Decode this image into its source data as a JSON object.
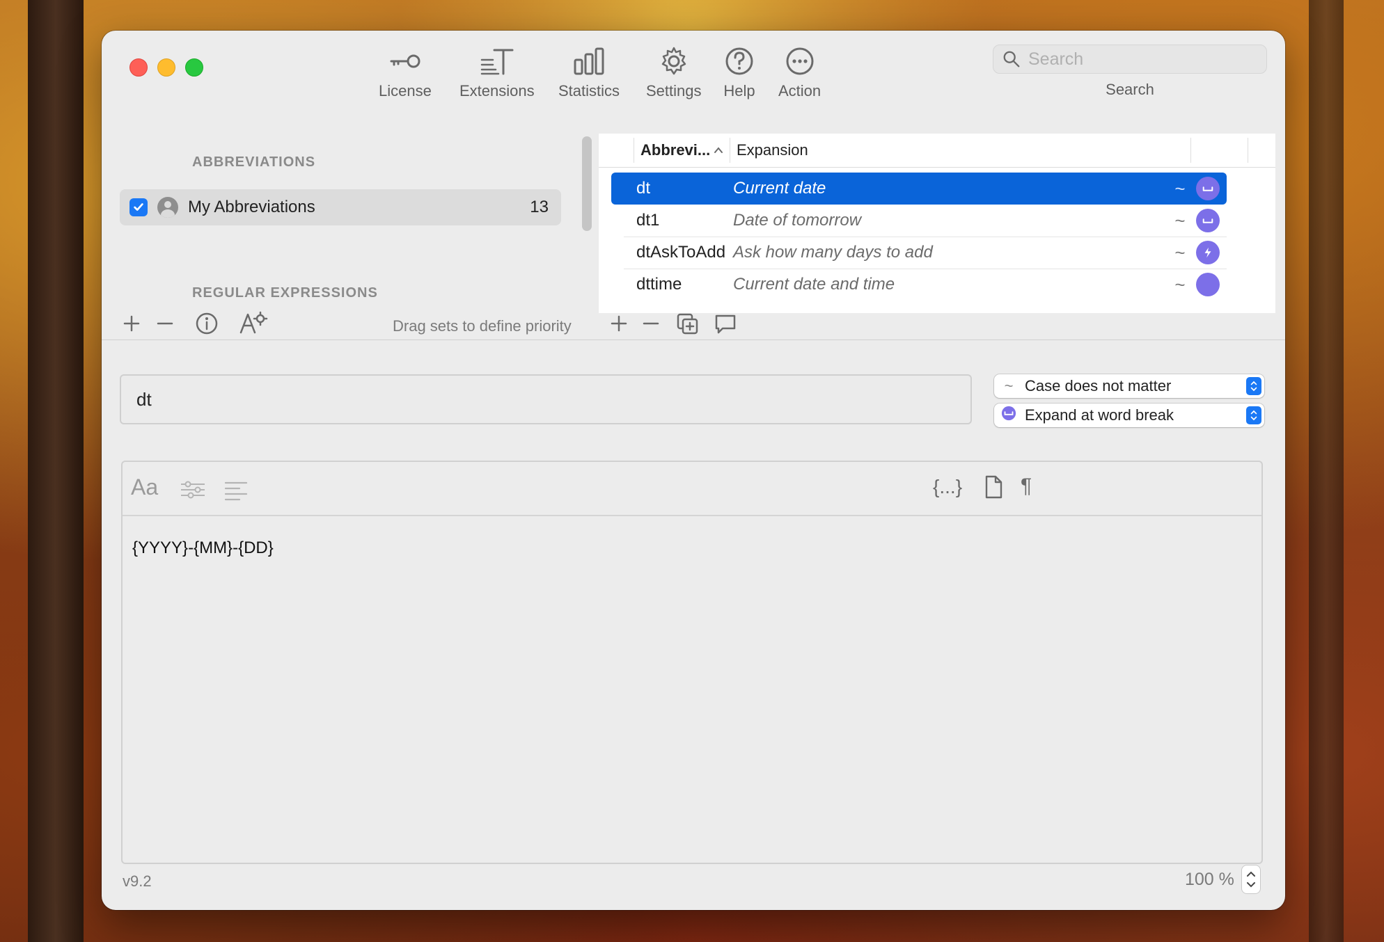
{
  "toolbar": {
    "license": "License",
    "extensions": "Extensions",
    "statistics": "Statistics",
    "settings": "Settings",
    "help": "Help",
    "action": "Action",
    "search_placeholder": "Search",
    "search_label": "Search"
  },
  "sidebar": {
    "abbreviations_header": "ABBREVIATIONS",
    "set_name": "My Abbreviations",
    "set_count": "13",
    "regex_header": "REGULAR EXPRESSIONS",
    "drag_hint": "Drag sets to define priority"
  },
  "table": {
    "col_abbreviation": "Abbrevi...",
    "col_expansion": "Expansion",
    "rows": [
      {
        "abbr": "dt",
        "expansion": "Current date",
        "case": "~",
        "trigger": "word-break-icon",
        "selected": true
      },
      {
        "abbr": "dt1",
        "expansion": "Date of tomorrow",
        "case": "~",
        "trigger": "word-break-icon",
        "selected": false
      },
      {
        "abbr": "dtAskToAdd",
        "expansion": "Ask how many days to add",
        "case": "~",
        "trigger": "lightning-icon",
        "selected": false
      },
      {
        "abbr": "dttime",
        "expansion": "Current date and time",
        "case": "~",
        "trigger": "word-break-icon",
        "selected": false
      }
    ]
  },
  "detail": {
    "abbreviation_value": "dt",
    "case_option": "Case does not matter",
    "expand_option": "Expand at word break",
    "editor_font_label": "Aa",
    "editor_placeholder_label": "{...}",
    "editor_pilcrow": "¶",
    "snippet_text": "{YYYY}-{MM}-{DD}"
  },
  "footer": {
    "version": "v9.2",
    "zoom": "100 %"
  },
  "colors": {
    "selection": "#0a64d9",
    "accent": "#1a78f5",
    "badge": "#7c6fe8"
  }
}
